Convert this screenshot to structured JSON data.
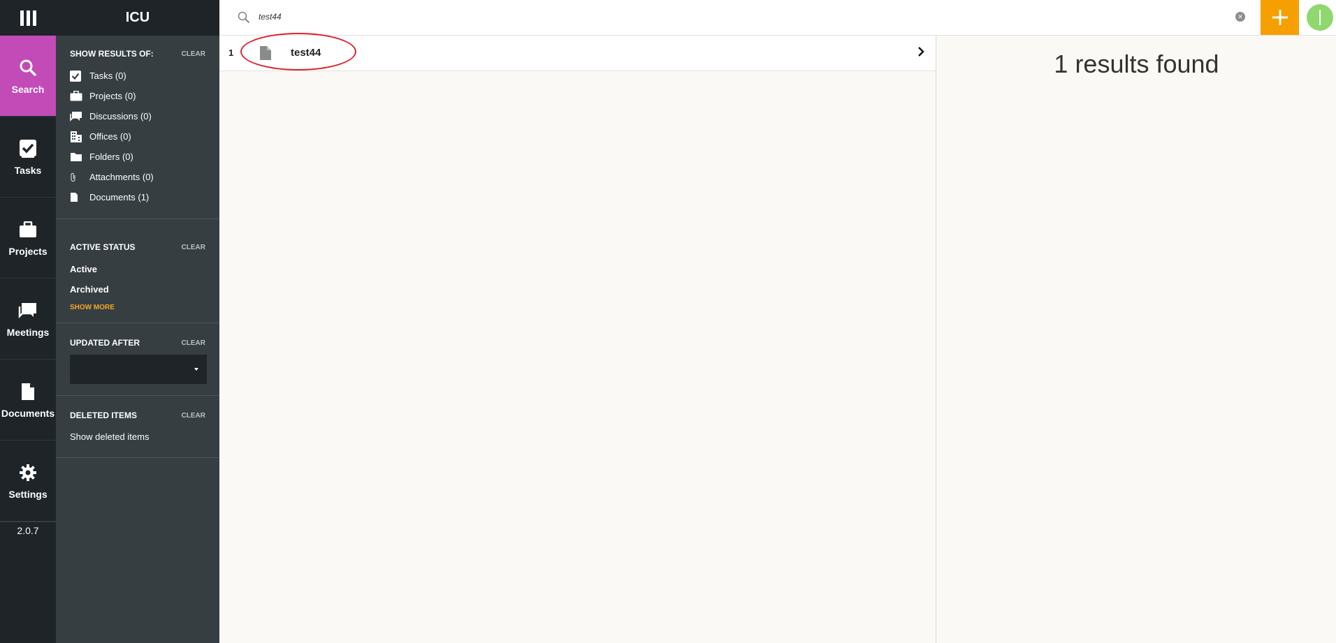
{
  "app": {
    "name": "ICU",
    "version": "2.0.7"
  },
  "nav": {
    "items": [
      {
        "label": "Search",
        "icon": "search-icon",
        "active": true
      },
      {
        "label": "Tasks",
        "icon": "check-icon"
      },
      {
        "label": "Projects",
        "icon": "briefcase-icon"
      },
      {
        "label": "Meetings",
        "icon": "chat-icon"
      },
      {
        "label": "Documents",
        "icon": "document-icon"
      },
      {
        "label": "Settings",
        "icon": "gear-icon"
      }
    ]
  },
  "filters": {
    "results_of": {
      "heading": "SHOW RESULTS OF:",
      "clear": "CLEAR",
      "items": [
        {
          "label": "Tasks (0)",
          "icon": "checkbox-icon"
        },
        {
          "label": "Projects (0)",
          "icon": "briefcase-icon"
        },
        {
          "label": "Discussions (0)",
          "icon": "chat-icon"
        },
        {
          "label": "Offices (0)",
          "icon": "building-icon"
        },
        {
          "label": "Folders (0)",
          "icon": "folder-icon"
        },
        {
          "label": "Attachments (0)",
          "icon": "paperclip-icon"
        },
        {
          "label": "Documents (1)",
          "icon": "document-icon"
        }
      ]
    },
    "active_status": {
      "heading": "ACTIVE STATUS",
      "clear": "CLEAR",
      "items": [
        "Active",
        "Archived"
      ],
      "show_more": "SHOW MORE"
    },
    "updated_after": {
      "heading": "UPDATED AFTER",
      "clear": "CLEAR",
      "value": ""
    },
    "deleted_items": {
      "heading": "DELETED ITEMS",
      "clear": "CLEAR",
      "link": "Show deleted items"
    }
  },
  "search": {
    "query": "test44"
  },
  "results": {
    "rows": [
      {
        "index": "1",
        "title": "test44",
        "icon": "document-icon"
      }
    ],
    "summary": "1 results found"
  },
  "colors": {
    "accent": "#c24bb8",
    "orange": "#f5a000",
    "sidebar": "#363e42",
    "rail": "#1e2428",
    "avatar": "#8ed86e",
    "annotation": "#e0212b"
  }
}
